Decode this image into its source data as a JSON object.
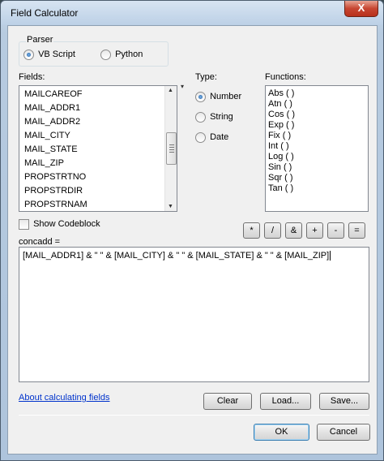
{
  "window": {
    "title": "Field Calculator",
    "close_glyph": "X"
  },
  "parser": {
    "legend": "Parser",
    "options": [
      {
        "label": "VB Script",
        "selected": true
      },
      {
        "label": "Python",
        "selected": false
      }
    ]
  },
  "fields": {
    "label": "Fields:",
    "items": [
      "MAILCAREOF",
      "MAIL_ADDR1",
      "MAIL_ADDR2",
      "MAIL_CITY",
      "MAIL_STATE",
      "MAIL_ZIP",
      "PROPSTRTNO",
      "PROPSTRDIR",
      "PROPSTRNAM"
    ],
    "selected": "MAIL_ZIP"
  },
  "type": {
    "label": "Type:",
    "options": [
      {
        "label": "Number",
        "selected": true
      },
      {
        "label": "String",
        "selected": false
      },
      {
        "label": "Date",
        "selected": false
      }
    ]
  },
  "functions": {
    "label": "Functions:",
    "items": [
      "Abs ( )",
      "Atn ( )",
      "Cos ( )",
      "Exp ( )",
      "Fix ( )",
      "Int ( )",
      "Log ( )",
      "Sin ( )",
      "Sqr ( )",
      "Tan ( )"
    ]
  },
  "show_codeblock": {
    "label": "Show Codeblock",
    "checked": false
  },
  "operators": [
    "*",
    "/",
    "&",
    "+",
    "-",
    "="
  ],
  "expression": {
    "label": "concadd =",
    "value": "[MAIL_ADDR1] & \" \" & [MAIL_CITY] & \" \" & [MAIL_STATE] & \" \" & [MAIL_ZIP]"
  },
  "help_link": "About calculating fields",
  "buttons": {
    "clear": "Clear",
    "load": "Load...",
    "save": "Save...",
    "ok": "OK",
    "cancel": "Cancel"
  },
  "colors": {
    "link": "#0033cc",
    "accent": "#1d5fa5"
  }
}
